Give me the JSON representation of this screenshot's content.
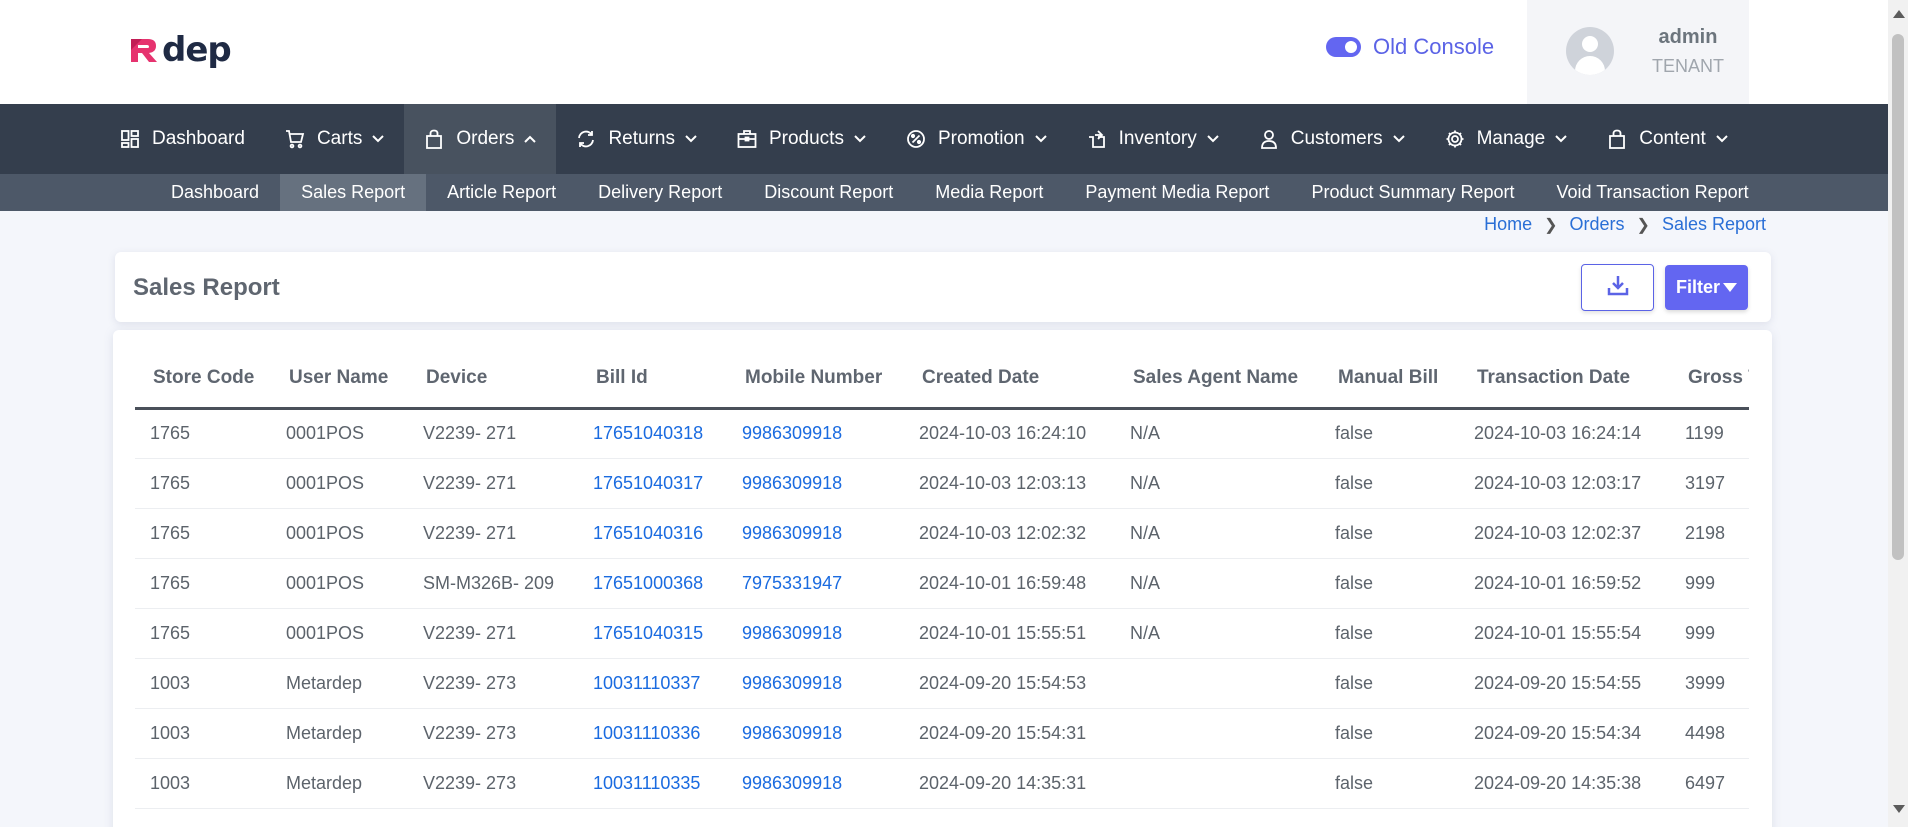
{
  "brand": {
    "logo_text": "dep",
    "accent": "#6366f1"
  },
  "header": {
    "console_label": "Old Console",
    "console_enabled": true,
    "user": {
      "name": "admin",
      "role": "TENANT"
    }
  },
  "nav": {
    "items": [
      {
        "label": "Dashboard",
        "icon": "dashboard-icon",
        "has_menu": false,
        "active": false
      },
      {
        "label": "Carts",
        "icon": "cart-icon",
        "has_menu": true,
        "active": false
      },
      {
        "label": "Orders",
        "icon": "bag-icon",
        "has_menu": true,
        "active": true
      },
      {
        "label": "Returns",
        "icon": "refresh-icon",
        "has_menu": true,
        "active": false
      },
      {
        "label": "Products",
        "icon": "briefcase-icon",
        "has_menu": true,
        "active": false
      },
      {
        "label": "Promotion",
        "icon": "badge-percent-icon",
        "has_menu": true,
        "active": false
      },
      {
        "label": "Inventory",
        "icon": "inventory-icon",
        "has_menu": true,
        "active": false
      },
      {
        "label": "Customers",
        "icon": "user-icon",
        "has_menu": true,
        "active": false
      },
      {
        "label": "Manage",
        "icon": "gear-icon",
        "has_menu": true,
        "active": false
      },
      {
        "label": "Content",
        "icon": "bag-icon",
        "has_menu": true,
        "active": false
      }
    ]
  },
  "subnav": {
    "items": [
      "Dashboard",
      "Sales Report",
      "Article Report",
      "Delivery Report",
      "Discount Report",
      "Media Report",
      "Payment Media Report",
      "Product Summary Report",
      "Void Transaction Report"
    ],
    "active_index": 1
  },
  "breadcrumb": {
    "items": [
      "Home",
      "Orders",
      "Sales Report"
    ]
  },
  "page": {
    "title": "Sales Report",
    "filter_label": "Filter"
  },
  "table": {
    "columns": [
      "Store Code",
      "User Name",
      "Device",
      "Bill Id",
      "Mobile Number",
      "Created Date",
      "Sales Agent Name",
      "Manual Bill",
      "Transaction Date",
      "Gross Total"
    ],
    "rows": [
      [
        "1765",
        "0001POS",
        "V2239- 271",
        "17651040318",
        "9986309918",
        "2024-10-03 16:24:10",
        "N/A",
        "false",
        "2024-10-03 16:24:14",
        "1199"
      ],
      [
        "1765",
        "0001POS",
        "V2239- 271",
        "17651040317",
        "9986309918",
        "2024-10-03 12:03:13",
        "N/A",
        "false",
        "2024-10-03 12:03:17",
        "3197"
      ],
      [
        "1765",
        "0001POS",
        "V2239- 271",
        "17651040316",
        "9986309918",
        "2024-10-03 12:02:32",
        "N/A",
        "false",
        "2024-10-03 12:02:37",
        "2198"
      ],
      [
        "1765",
        "0001POS",
        "SM-M326B- 209",
        "17651000368",
        "7975331947",
        "2024-10-01 16:59:48",
        "N/A",
        "false",
        "2024-10-01 16:59:52",
        "999"
      ],
      [
        "1765",
        "0001POS",
        "V2239- 271",
        "17651040315",
        "9986309918",
        "2024-10-01 15:55:51",
        "N/A",
        "false",
        "2024-10-01 15:55:54",
        "999"
      ],
      [
        "1003",
        "Metardep",
        "V2239- 273",
        "10031110337",
        "9986309918",
        "2024-09-20 15:54:53",
        "",
        "false",
        "2024-09-20 15:54:55",
        "3999"
      ],
      [
        "1003",
        "Metardep",
        "V2239- 273",
        "10031110336",
        "9986309918",
        "2024-09-20 15:54:31",
        "",
        "false",
        "2024-09-20 15:54:34",
        "4498"
      ],
      [
        "1003",
        "Metardep",
        "V2239- 273",
        "10031110335",
        "9986309918",
        "2024-09-20 14:35:31",
        "",
        "false",
        "2024-09-20 14:35:38",
        "6497"
      ]
    ]
  }
}
